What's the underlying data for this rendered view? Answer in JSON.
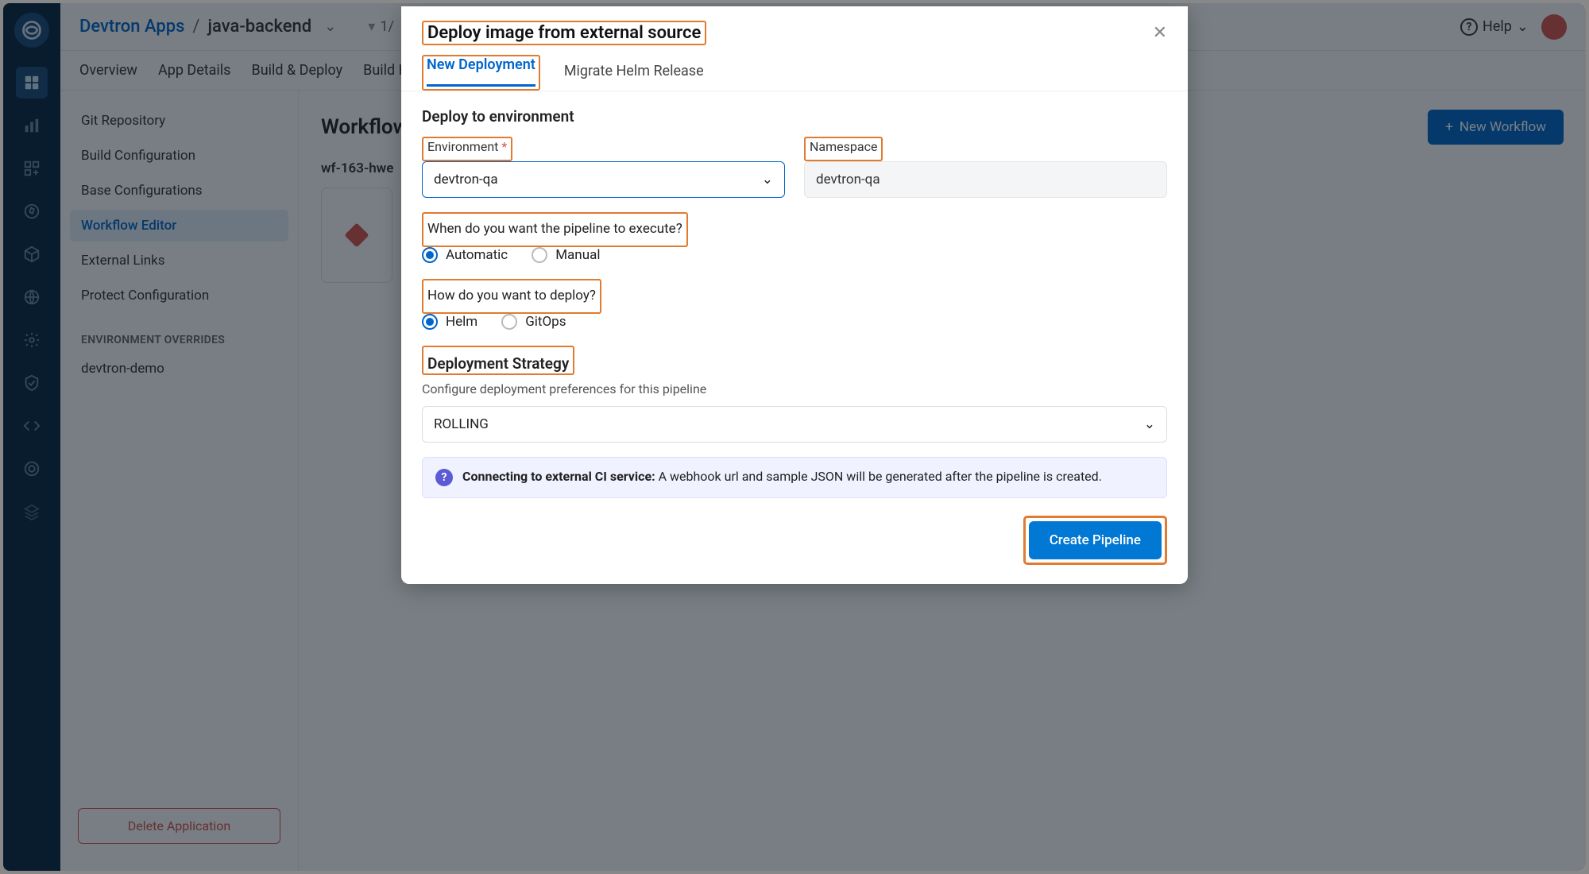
{
  "topbar": {
    "breadcrumb_root": "Devtron Apps",
    "breadcrumb_sep": "/",
    "breadcrumb_leaf": "java-backend",
    "filter_text": "1/",
    "help_label": "Help"
  },
  "tabs": [
    "Overview",
    "App Details",
    "Build & Deploy",
    "Build Hist"
  ],
  "sidebar": {
    "items": [
      "Git Repository",
      "Build Configuration",
      "Base Configurations",
      "Workflow Editor",
      "External Links",
      "Protect Configuration"
    ],
    "active_index": 3,
    "group_label": "ENVIRONMENT OVERRIDES",
    "env_items": [
      "devtron-demo"
    ],
    "delete_label": "Delete Application"
  },
  "content": {
    "heading": "Workflow",
    "new_workflow_btn": "New Workflow",
    "workflow_name": "wf-163-hwe"
  },
  "modal": {
    "title": "Deploy image from external source",
    "tabs": {
      "new": "New Deployment",
      "migrate": "Migrate Helm Release"
    },
    "section_deploy_env": "Deploy to environment",
    "env_label": "Environment",
    "env_value": "devtron-qa",
    "ns_label": "Namespace",
    "ns_value": "devtron-qa",
    "exec_question": "When do you want the pipeline to execute?",
    "exec_options": {
      "auto": "Automatic",
      "manual": "Manual"
    },
    "deploy_question": "How do you want to deploy?",
    "deploy_options": {
      "helm": "Helm",
      "gitops": "GitOps"
    },
    "strategy_title": "Deployment Strategy",
    "strategy_sub": "Configure deployment preferences for this pipeline",
    "strategy_value": "ROLLING",
    "info_bold": "Connecting to external CI service:",
    "info_rest": " A webhook url and sample JSON will be generated after the pipeline is created.",
    "create_btn": "Create Pipeline"
  }
}
